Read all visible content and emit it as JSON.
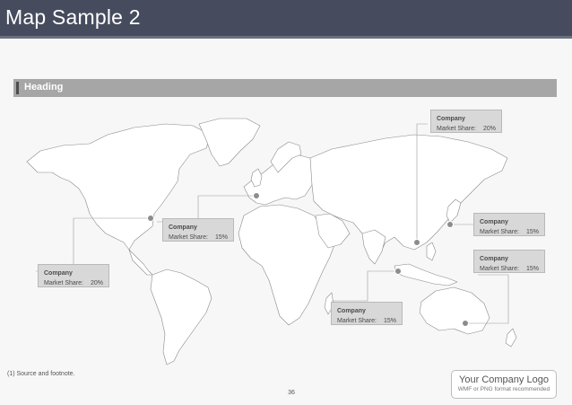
{
  "header": {
    "title": "Map Sample 2"
  },
  "section": {
    "heading": "Heading"
  },
  "callouts": [
    {
      "company": "Company",
      "label": "Market Share:",
      "value": "20%"
    },
    {
      "company": "Company",
      "label": "Market Share:",
      "value": "15%"
    },
    {
      "company": "Company",
      "label": "Market Share:",
      "value": "15%"
    },
    {
      "company": "Company",
      "label": "Market Share:",
      "value": "15%"
    },
    {
      "company": "Company",
      "label": "Market Share:",
      "value": "15%"
    },
    {
      "company": "Company",
      "label": "Market Share:",
      "value": "20%"
    }
  ],
  "footer": {
    "footnote": "(1)  Source and footnote.",
    "page_number": "36",
    "logo_title": "Your Company Logo",
    "logo_subtitle": "WMF or PNG format recommended"
  },
  "colors": {
    "title_bar": "#464c5e",
    "heading_bar": "#a6a6a6",
    "callout_fill": "#d8d8d8",
    "marker": "#8c8c8c"
  }
}
